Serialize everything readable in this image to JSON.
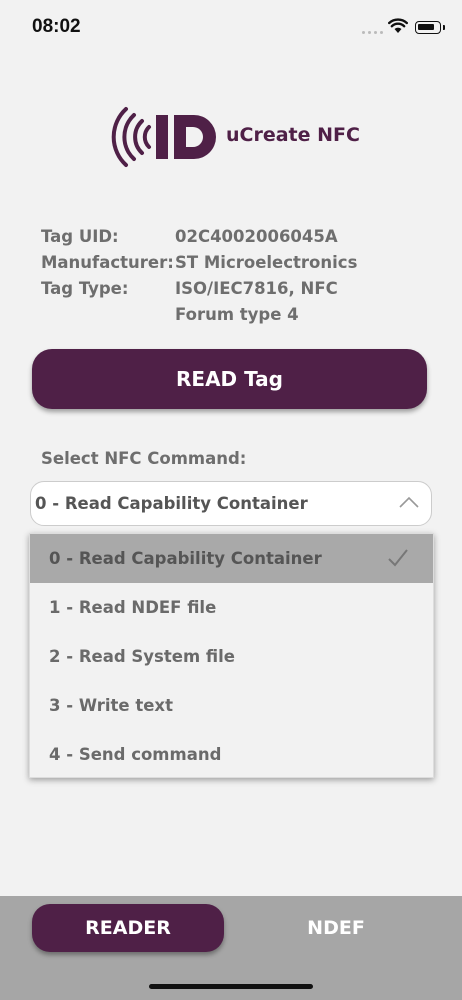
{
  "status_bar": {
    "time": "08:02"
  },
  "brand": {
    "logo_text": "ID",
    "app_name": "uCreate NFC",
    "color": "#4f2047"
  },
  "tag_info": [
    {
      "label": "Tag UID:",
      "value": "02C4002006045A"
    },
    {
      "label": "Manufacturer:",
      "value": "ST Microelectronics"
    },
    {
      "label": "Tag Type:",
      "value": "ISO/IEC7816, NFC Forum type 4"
    }
  ],
  "read_button": {
    "label": "READ Tag"
  },
  "command_select": {
    "label": "Select NFC Command:",
    "selected_value": "0 - Read Capability Container",
    "options": [
      "0 - Read Capability Container",
      "1 - Read NDEF file",
      "2 - Read System file",
      "3 - Write text",
      "4 - Send command"
    ]
  },
  "tab_bar": {
    "reader_label": "READER",
    "ndef_label": "NDEF"
  }
}
